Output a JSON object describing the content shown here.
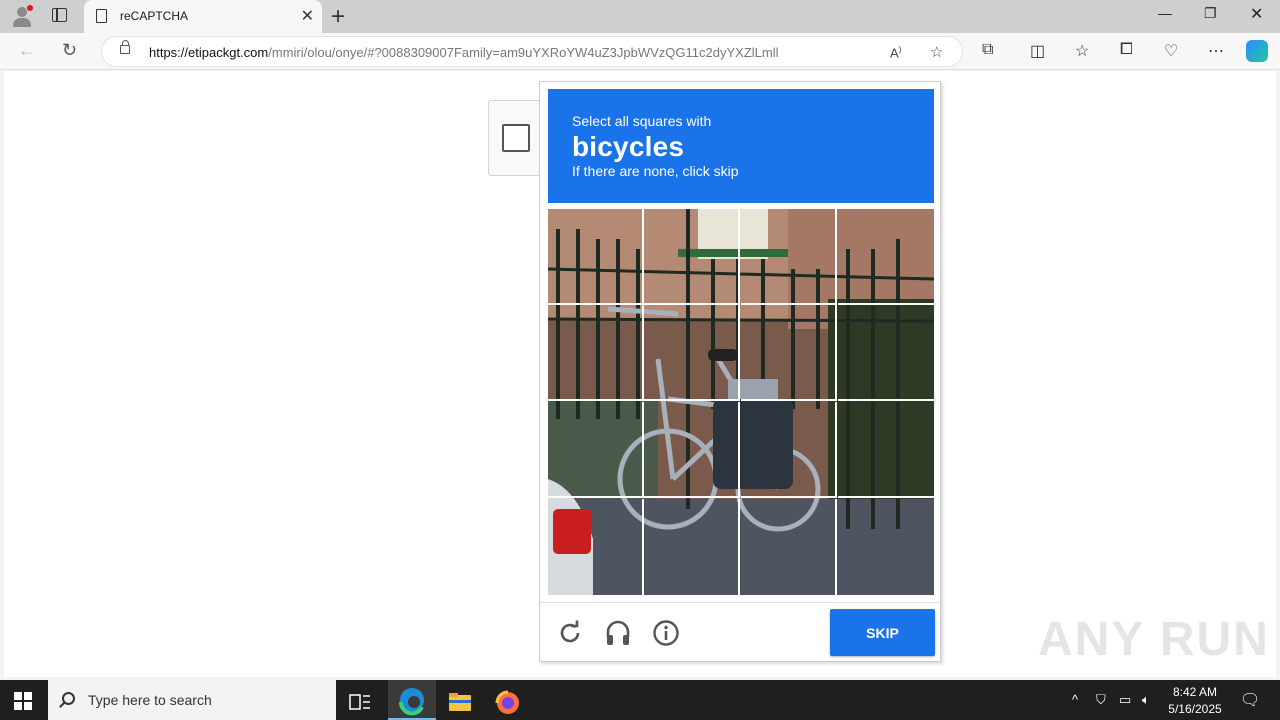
{
  "browser": {
    "tab_title": "reCAPTCHA",
    "url_host": "https://etipackgt.com",
    "url_path": "/mmiri/olou/onye/#?0088309007Family=am9uYXRoYW4uZ3JpbWVzQG11c2dyYXZlLmll"
  },
  "captcha": {
    "line1": "Select all squares with",
    "target": "bicycles",
    "line3": "If there are none, click skip",
    "skip_label": "SKIP",
    "grid_rows": 4,
    "grid_cols": 4
  },
  "watermark": "ANY RUN",
  "taskbar": {
    "search_placeholder": "Type here to search",
    "time": "8:42 AM",
    "date": "5/16/2025"
  },
  "colors": {
    "accent": "#1a73e8"
  }
}
